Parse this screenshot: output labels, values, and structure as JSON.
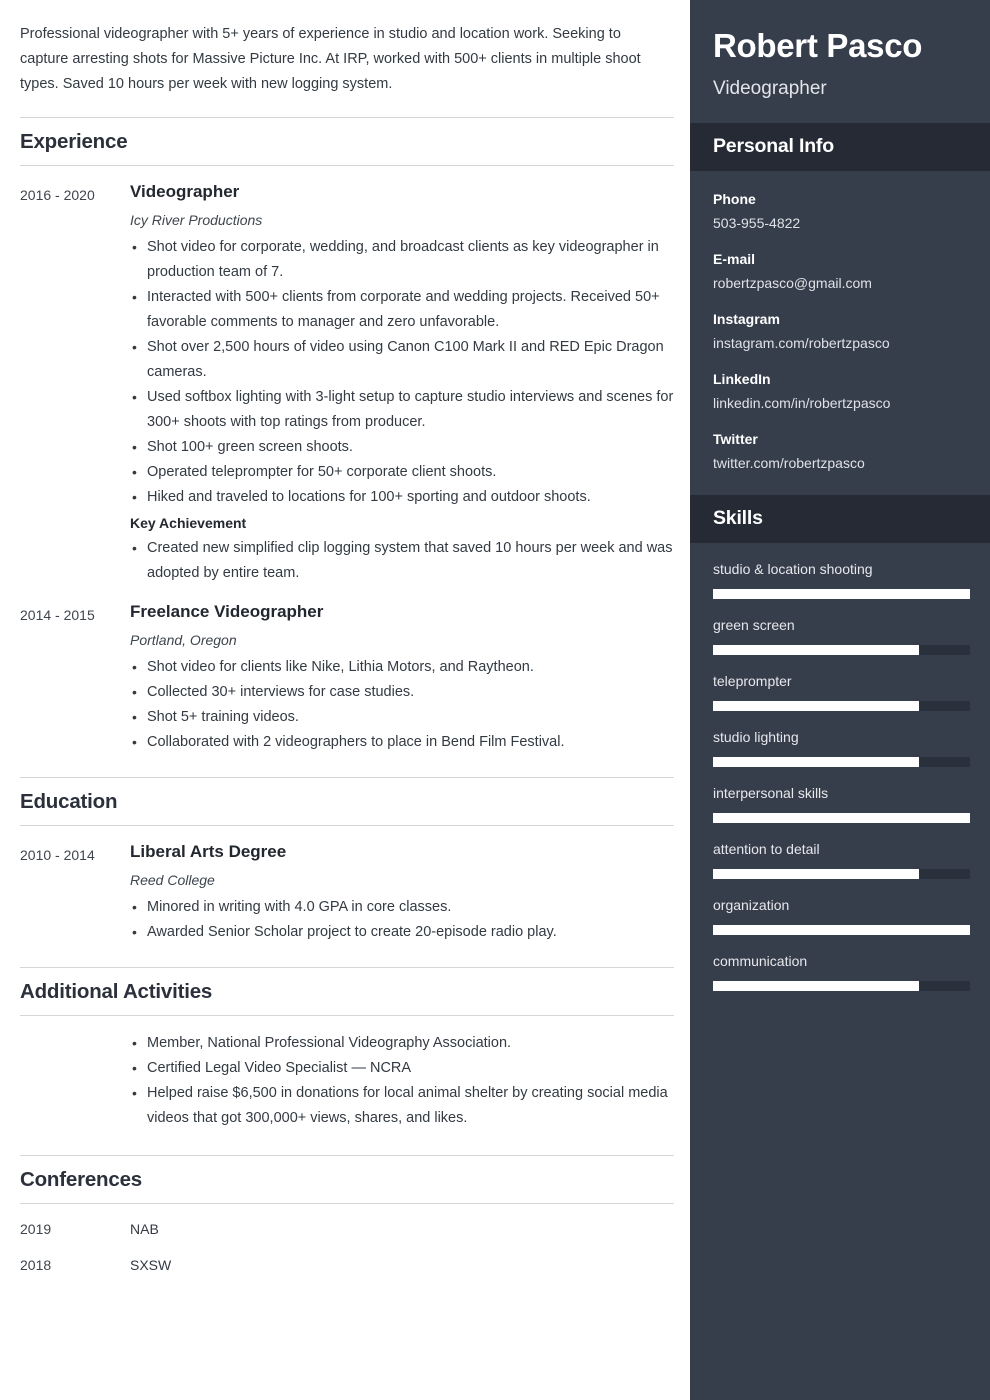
{
  "summary": "Professional videographer with 5+ years of experience in studio and location work. Seeking to capture arresting shots for Massive Picture Inc. At IRP, worked with 500+ clients in multiple shoot types. Saved 10 hours per week with new logging system.",
  "sections": {
    "experience_title": "Experience",
    "education_title": "Education",
    "activities_title": "Additional Activities",
    "conferences_title": "Conferences"
  },
  "experience": [
    {
      "dates": "2016 - 2020",
      "role": "Videographer",
      "org": "Icy River Productions",
      "bullets": [
        "Shot video for corporate, wedding, and broadcast clients as key videographer in production team of 7.",
        "Interacted with 500+ clients from corporate and wedding projects. Received 50+ favorable comments to manager and zero unfavorable.",
        "Shot over 2,500 hours of video using Canon C100 Mark II and RED Epic Dragon cameras.",
        "Used softbox lighting with 3-light setup to capture studio interviews and scenes for 300+ shoots with top ratings from producer.",
        "Shot 100+ green screen shoots.",
        "Operated teleprompter for 50+ corporate client shoots.",
        "Hiked and traveled to locations for 100+ sporting and outdoor shoots."
      ],
      "key_achievement_label": "Key Achievement",
      "key_achievement_bullets": [
        "Created new simplified clip logging system that saved 10 hours per week and was adopted by entire team."
      ]
    },
    {
      "dates": "2014 - 2015",
      "role": "Freelance Videographer",
      "org": "Portland, Oregon",
      "bullets": [
        "Shot video for clients like Nike, Lithia Motors, and Raytheon.",
        "Collected 30+ interviews for case studies.",
        "Shot 5+ training videos.",
        "Collaborated with 2 videographers to place in Bend Film Festival."
      ],
      "key_achievement_label": "",
      "key_achievement_bullets": []
    }
  ],
  "education": [
    {
      "dates": "2010 - 2014",
      "role": "Liberal Arts Degree",
      "org": "Reed College",
      "bullets": [
        "Minored in writing with 4.0 GPA in core classes.",
        "Awarded Senior Scholar project to create 20-episode radio play."
      ]
    }
  ],
  "activities": [
    "Member, National Professional Videography Association.",
    "Certified Legal Video Specialist — NCRA",
    "Helped raise $6,500 in donations for local animal shelter by creating social media videos that got 300,000+ views, shares, and likes."
  ],
  "conferences": [
    {
      "year": "2019",
      "name": "NAB"
    },
    {
      "year": "2018",
      "name": "SXSW"
    }
  ],
  "sidebar": {
    "name": "Robert Pasco",
    "job_title": "Videographer",
    "personal_info_title": "Personal Info",
    "skills_title": "Skills",
    "contacts": [
      {
        "label": "Phone",
        "value": "503-955-4822"
      },
      {
        "label": "E-mail",
        "value": "robertzpasco@gmail.com"
      },
      {
        "label": "Instagram",
        "value": "instagram.com/robertzpasco"
      },
      {
        "label": "LinkedIn",
        "value": "linkedin.com/in/robertzpasco"
      },
      {
        "label": "Twitter",
        "value": "twitter.com/robertzpasco"
      }
    ],
    "skills": [
      {
        "name": "studio & location shooting",
        "level": 100
      },
      {
        "name": "green screen",
        "level": 80
      },
      {
        "name": "teleprompter",
        "level": 80
      },
      {
        "name": "studio lighting",
        "level": 80
      },
      {
        "name": "interpersonal skills",
        "level": 100
      },
      {
        "name": "attention to detail",
        "level": 80
      },
      {
        "name": "organization",
        "level": 100
      },
      {
        "name": "communication",
        "level": 80
      }
    ]
  },
  "colors": {
    "sidebar_bg": "#363d4b",
    "sidebar_band_bg": "#252a34",
    "skill_track": "#2b313c",
    "skill_fill": "#ffffff",
    "rule": "#d6d6d6",
    "heading": "#2b303b",
    "body_text": "#333a42"
  }
}
